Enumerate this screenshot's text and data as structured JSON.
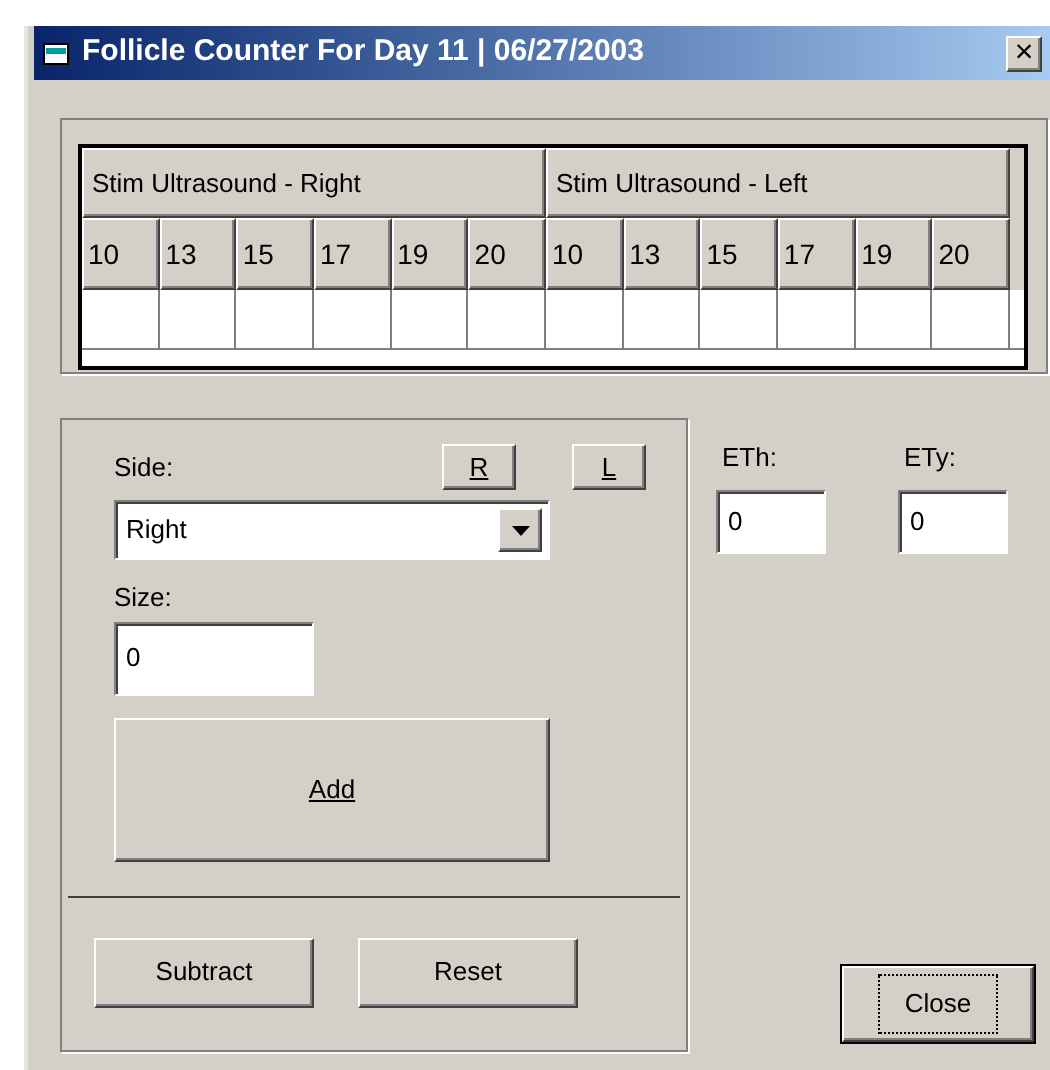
{
  "window": {
    "title": "Follicle Counter For Day 11 | 06/27/2003",
    "close_glyph": "×"
  },
  "grid": {
    "groups": [
      "Stim Ultrasound - Right",
      "Stim Ultrasound - Left"
    ],
    "columns": [
      "10",
      "13",
      "15",
      "17",
      "19",
      "20",
      "10",
      "13",
      "15",
      "17",
      "19",
      "20"
    ]
  },
  "side": {
    "label": "Side:",
    "value": "Right",
    "buttons": [
      "R",
      "L"
    ]
  },
  "size": {
    "label": "Size:",
    "value": "0"
  },
  "add_button": "Add",
  "bottom_buttons": [
    "Subtract",
    "Reset"
  ],
  "fields": [
    {
      "label": "ETh:",
      "value": "0"
    },
    {
      "label": "ETy:",
      "value": "0"
    }
  ],
  "close_button": {
    "label": "Close",
    "focused": true
  }
}
